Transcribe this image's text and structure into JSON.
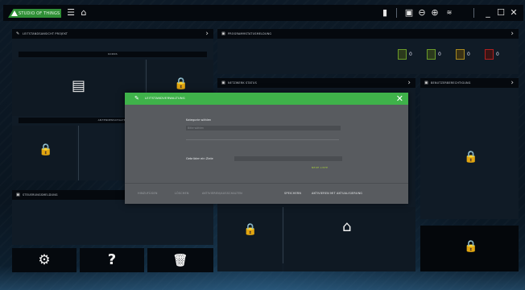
{
  "app": {
    "logo_text": "STUDIO OF THINGS"
  },
  "topbar": {
    "icons": [
      "menu-icon",
      "home-icon",
      "sidebar-icon",
      "window-icon",
      "zoom-out-icon",
      "zoom-in-icon",
      "wifi-icon",
      "minimize-icon",
      "maximize-icon",
      "close-icon"
    ],
    "glyphs": {
      "menu": "☰",
      "home": "⌂",
      "sidebar": "▮",
      "window": "▣",
      "zoom_out": "⊖",
      "zoom_in": "⊕",
      "wifi": "≋",
      "minimize": "_",
      "maximize": "☐",
      "close": "✕"
    }
  },
  "panels": {
    "left_top": {
      "title": "LEITSTANDSANSICHT PROJEKT",
      "strip1": "KORNS",
      "strip2": "ANTENNENSCHALTER",
      "chevron": "›"
    },
    "right_top": {
      "title": "PROGRAMMSTATUSMELDUNG",
      "chevron": "›",
      "counters": [
        {
          "value": "0",
          "color": "#6a9a2a"
        },
        {
          "value": "0",
          "color": "#6a9a2a"
        },
        {
          "value": "0",
          "color": "#a88a20"
        },
        {
          "value": "0",
          "color": "#b02020"
        }
      ]
    },
    "mid_right": {
      "title": "NETZWERK STATUS",
      "chevron": "›"
    },
    "far_right": {
      "title": "BENUTZERBERECHTIGUNG",
      "chevron": "›"
    },
    "left_bottom": {
      "title": "STEUERUNGSMELDUNG"
    }
  },
  "buttons": {
    "settings_glyph": "⚙",
    "help_glyph": "?",
    "delete_glyph": "🗑"
  },
  "lock_glyph": "🔒",
  "home_glyph": "⌂",
  "modal": {
    "title": "LEITSTANDVERWALTUNG",
    "close": "✕",
    "label_category": "Kategorie wählen",
    "field_category": "Bitte wählen",
    "label_project": "Gebrüder ein Ziele",
    "field_project": "",
    "green_link": "NEUE LISTE",
    "footer": [
      {
        "text": "HINZUFÜGEN",
        "active": false
      },
      {
        "text": "LÖSCHEN",
        "active": false
      },
      {
        "text": "AKTIVIEREN/AUSSCHALTEN",
        "active": false
      },
      {
        "text": "SPEICHERN",
        "active": true
      },
      {
        "text": "AKTIVIEREN MIT AKTUALISIERUNG",
        "active": true
      }
    ]
  }
}
